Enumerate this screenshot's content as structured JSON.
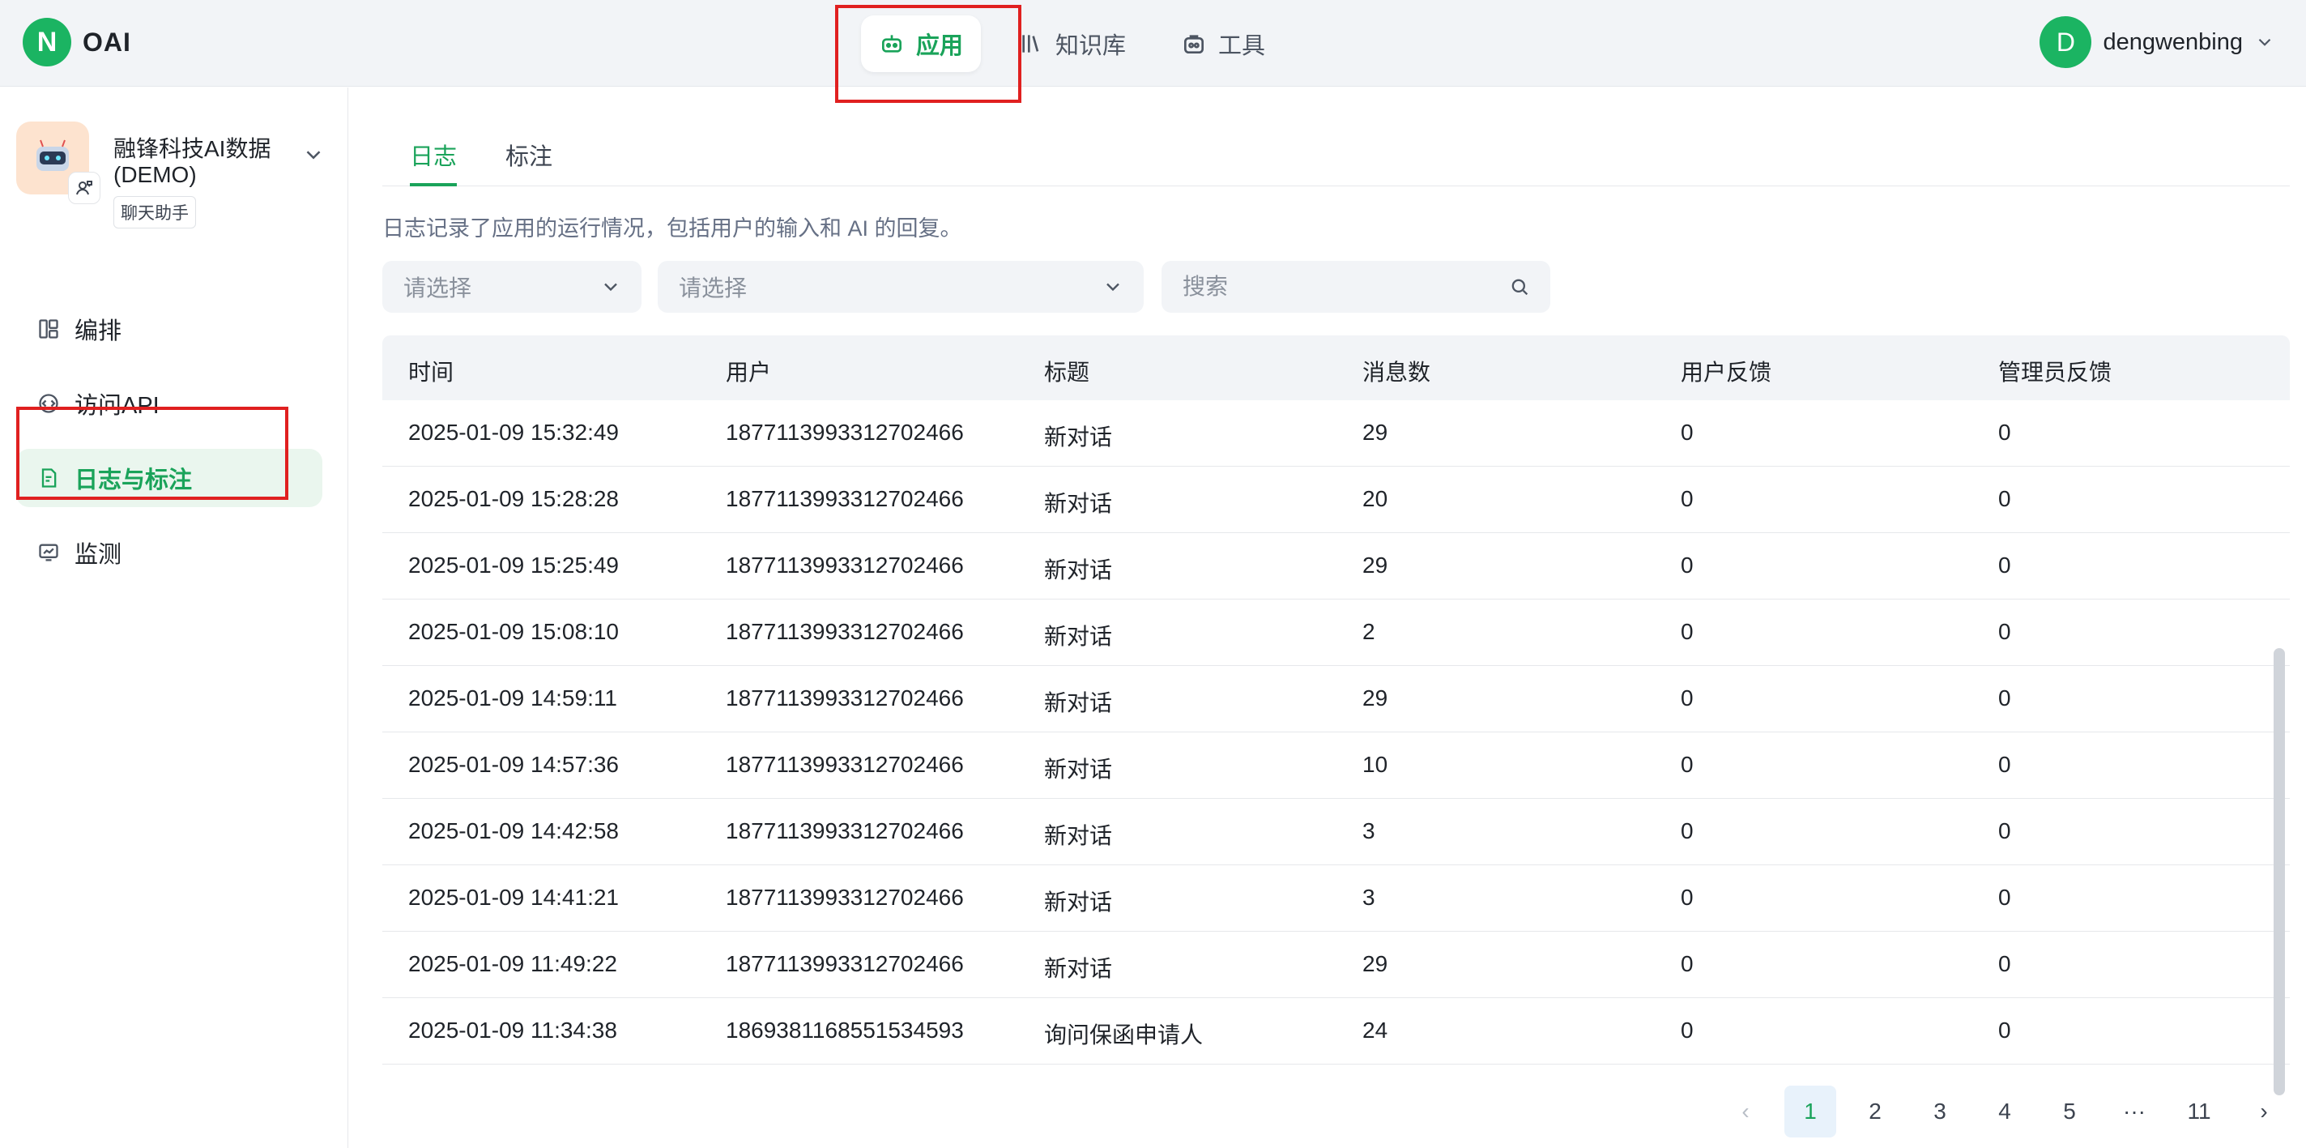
{
  "brand": {
    "logo_letter": "N",
    "name": "OAI"
  },
  "nav": {
    "items": [
      {
        "label": "应用",
        "icon": "robot-icon"
      },
      {
        "label": "知识库",
        "icon": "book-icon"
      },
      {
        "label": "工具",
        "icon": "toolbox-icon"
      }
    ]
  },
  "user": {
    "initial": "D",
    "name": "dengwenbing"
  },
  "app": {
    "name": "融锋科技AI数据(DEMO)",
    "type": "聊天助手",
    "icon": "robot-avatar-icon"
  },
  "sidebar": {
    "items": [
      {
        "label": "编排",
        "icon": "layout-icon"
      },
      {
        "label": "访问API",
        "icon": "api-icon"
      },
      {
        "label": "日志与标注",
        "icon": "log-icon"
      },
      {
        "label": "监测",
        "icon": "monitor-icon"
      }
    ]
  },
  "tabs": [
    {
      "label": "日志"
    },
    {
      "label": "标注"
    }
  ],
  "description": "日志记录了应用的运行情况，包括用户的输入和 AI 的回复。",
  "filters": {
    "select1": {
      "placeholder": "请选择"
    },
    "select2": {
      "placeholder": "请选择"
    },
    "search": {
      "placeholder": "搜索"
    }
  },
  "table": {
    "headers": [
      "时间",
      "用户",
      "标题",
      "消息数",
      "用户反馈",
      "管理员反馈"
    ],
    "rows": [
      [
        "2025-01-09 15:32:49",
        "1877113993312702466",
        "新对话",
        "29",
        "0",
        "0"
      ],
      [
        "2025-01-09 15:28:28",
        "1877113993312702466",
        "新对话",
        "20",
        "0",
        "0"
      ],
      [
        "2025-01-09 15:25:49",
        "1877113993312702466",
        "新对话",
        "29",
        "0",
        "0"
      ],
      [
        "2025-01-09 15:08:10",
        "1877113993312702466",
        "新对话",
        "2",
        "0",
        "0"
      ],
      [
        "2025-01-09 14:59:11",
        "1877113993312702466",
        "新对话",
        "29",
        "0",
        "0"
      ],
      [
        "2025-01-09 14:57:36",
        "1877113993312702466",
        "新对话",
        "10",
        "0",
        "0"
      ],
      [
        "2025-01-09 14:42:58",
        "1877113993312702466",
        "新对话",
        "3",
        "0",
        "0"
      ],
      [
        "2025-01-09 14:41:21",
        "1877113993312702466",
        "新对话",
        "3",
        "0",
        "0"
      ],
      [
        "2025-01-09 11:49:22",
        "1877113993312702466",
        "新对话",
        "29",
        "0",
        "0"
      ],
      [
        "2025-01-09 11:34:38",
        "1869381168551534593",
        "询问保函申请人",
        "24",
        "0",
        "0"
      ]
    ]
  },
  "pagination": {
    "prev": "‹",
    "pages": [
      "1",
      "2",
      "3",
      "4",
      "5",
      "···",
      "11"
    ],
    "next": "›",
    "current": "1"
  },
  "colors": {
    "accent": "#1aa35a",
    "highlight_box": "#e02020"
  }
}
